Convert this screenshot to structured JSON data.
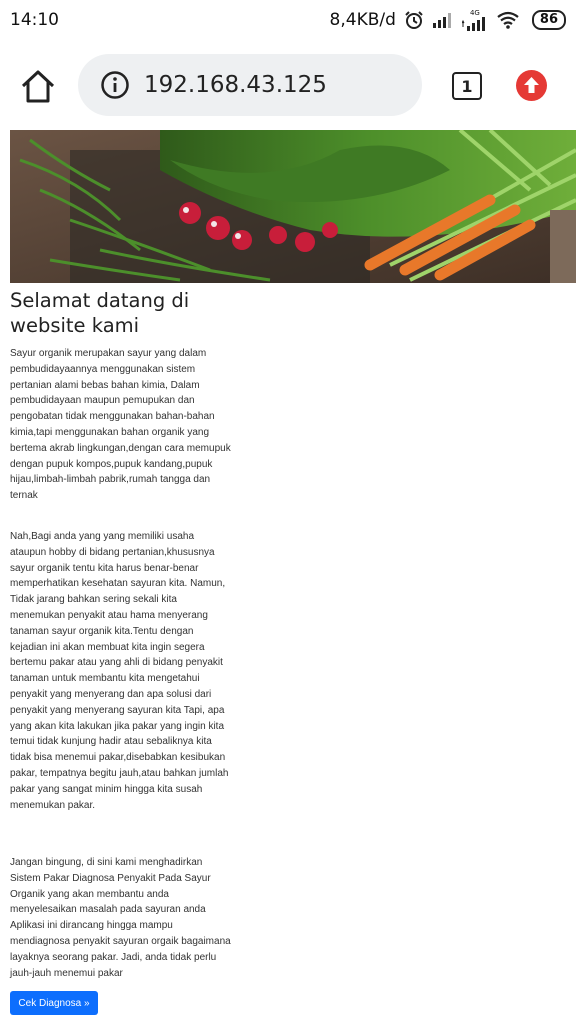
{
  "status_bar": {
    "time": "14:10",
    "speed": "8,4KB/d",
    "network_label": "4G",
    "battery": "86"
  },
  "browser": {
    "url": "192.168.43.125",
    "tab_count": "1"
  },
  "page": {
    "title": "Selamat datang di website kami",
    "paragraph_1": "Sayur organik merupakan sayur yang dalam pembudidayaannya menggunakan sistem pertanian alami bebas bahan kimia, Dalam pembudidayaan maupun pemupukan dan pengobatan tidak menggunakan bahan-bahan kimia,tapi menggunakan bahan organik yang bertema akrab lingkungan,dengan cara memupuk dengan pupuk kompos,pupuk kandang,pupuk hijau,limbah-limbah pabrik,rumah tangga dan ternak",
    "paragraph_2": "Nah,Bagi anda yang yang memiliki usaha ataupun hobby di bidang pertanian,khususnya sayur organik tentu kita harus benar-benar memperhatikan kesehatan sayuran kita. Namun, Tidak jarang bahkan sering sekali kita menemukan penyakit atau hama menyerang tanaman sayur organik kita.Tentu dengan kejadian ini akan membuat kita ingin segera bertemu pakar atau yang ahli di bidang penyakit tanaman untuk membantu kita mengetahui penyakit yang menyerang dan apa solusi dari penyakit yang menyerang sayuran kita Tapi, apa yang akan kita lakukan jika pakar yang ingin kita temui tidak kunjung hadir atau sebaliknya kita tidak bisa menemui pakar,disebabkan kesibukan pakar, tempatnya begitu jauh,atau bahkan jumlah pakar yang sangat minim hingga kita susah menemukan pakar.",
    "paragraph_3": "Jangan bingung, di sini kami menghadirkan Sistem Pakar Diagnosa Penyakit Pada Sayur Organik yang akan membantu anda menyelesaikan masalah pada sayuran anda Aplikasi ini dirancang hingga mampu mendiagnosa penyakit sayuran orgaik bagaimana layaknya seorang pakar. Jadi, anda tidak perlu jauh-jauh menemui pakar",
    "cta_label": "Cek Diagnosa »"
  },
  "colors": {
    "accent": "#0d6efd",
    "update_icon_bg": "#e53935",
    "urlbar_bg": "#eef0f2"
  },
  "icons": [
    "home-icon",
    "info-icon",
    "tabs-icon",
    "update-arrow-icon",
    "alarm-icon",
    "signal-icon",
    "wifi-icon",
    "battery-icon"
  ]
}
